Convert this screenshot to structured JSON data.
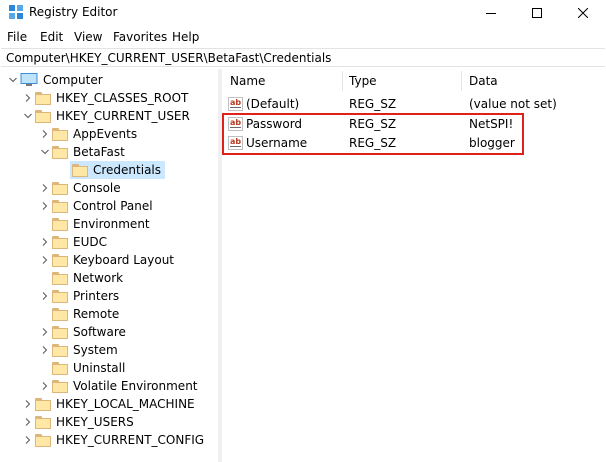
{
  "window": {
    "title": "Registry Editor"
  },
  "menu": [
    "File",
    "Edit",
    "View",
    "Favorites",
    "Help"
  ],
  "address": "Computer\\HKEY_CURRENT_USER\\BetaFast\\Credentials",
  "tree": {
    "root": "Computer",
    "hives": {
      "classes_root": "HKEY_CLASSES_ROOT",
      "current_user": "HKEY_CURRENT_USER",
      "local_machine": "HKEY_LOCAL_MACHINE",
      "users": "HKEY_USERS",
      "current_config": "HKEY_CURRENT_CONFIG"
    },
    "current_user_children": [
      "AppEvents",
      "BetaFast",
      "Credentials",
      "Console",
      "Control Panel",
      "Environment",
      "EUDC",
      "Keyboard Layout",
      "Network",
      "Printers",
      "Remote",
      "Software",
      "System",
      "Uninstall",
      "Volatile Environment"
    ]
  },
  "list": {
    "columns": [
      "Name",
      "Type",
      "Data"
    ],
    "rows": [
      {
        "name": "(Default)",
        "type": "REG_SZ",
        "data": "(value not set)"
      },
      {
        "name": "Password",
        "type": "REG_SZ",
        "data": "NetSPI!"
      },
      {
        "name": "Username",
        "type": "REG_SZ",
        "data": "blogger"
      }
    ]
  },
  "colors": {
    "selection": "#cce8ff",
    "highlight_border": "#e0201b",
    "folder": "#ffe8a6"
  }
}
